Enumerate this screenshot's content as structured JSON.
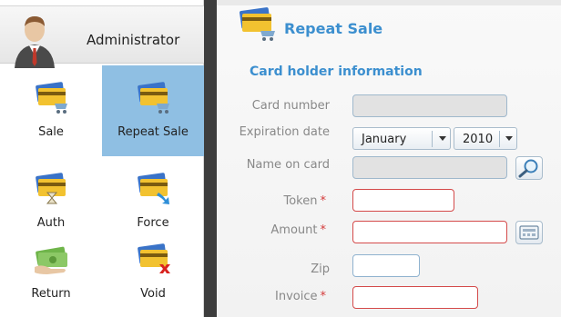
{
  "user": {
    "name": "Administrator"
  },
  "menu": [
    {
      "id": "sale",
      "label": "Sale",
      "icon": "credit-cards-cart-icon",
      "active": false
    },
    {
      "id": "repeat-sale",
      "label": "Repeat Sale",
      "icon": "credit-cards-cart-icon",
      "active": true
    },
    {
      "id": "auth",
      "label": "Auth",
      "icon": "credit-cards-hourglass-icon",
      "active": false
    },
    {
      "id": "force",
      "label": "Force",
      "icon": "credit-cards-arrow-icon",
      "active": false
    },
    {
      "id": "return",
      "label": "Return",
      "icon": "money-hand-icon",
      "active": false
    },
    {
      "id": "void",
      "label": "Void",
      "icon": "credit-cards-x-icon",
      "active": false
    }
  ],
  "page": {
    "title": "Repeat Sale",
    "section": "Card holder information"
  },
  "form": {
    "card_number": {
      "label": "Card number",
      "value": ""
    },
    "expiration": {
      "label": "Expiration date",
      "month": "January",
      "year": "2010"
    },
    "name_on_card": {
      "label": "Name on card",
      "value": ""
    },
    "token": {
      "label": "Token",
      "required_mark": "*",
      "value": ""
    },
    "amount": {
      "label": "Amount",
      "required_mark": "*",
      "value": ""
    },
    "zip": {
      "label": "Zip",
      "value": ""
    },
    "invoice": {
      "label": "Invoice",
      "required_mark": "*",
      "value": ""
    }
  },
  "colors": {
    "accent": "#3c8fcf",
    "active_tile": "#8fbfe3",
    "required": "#d43a3a",
    "divider": "#3d3d3d"
  }
}
